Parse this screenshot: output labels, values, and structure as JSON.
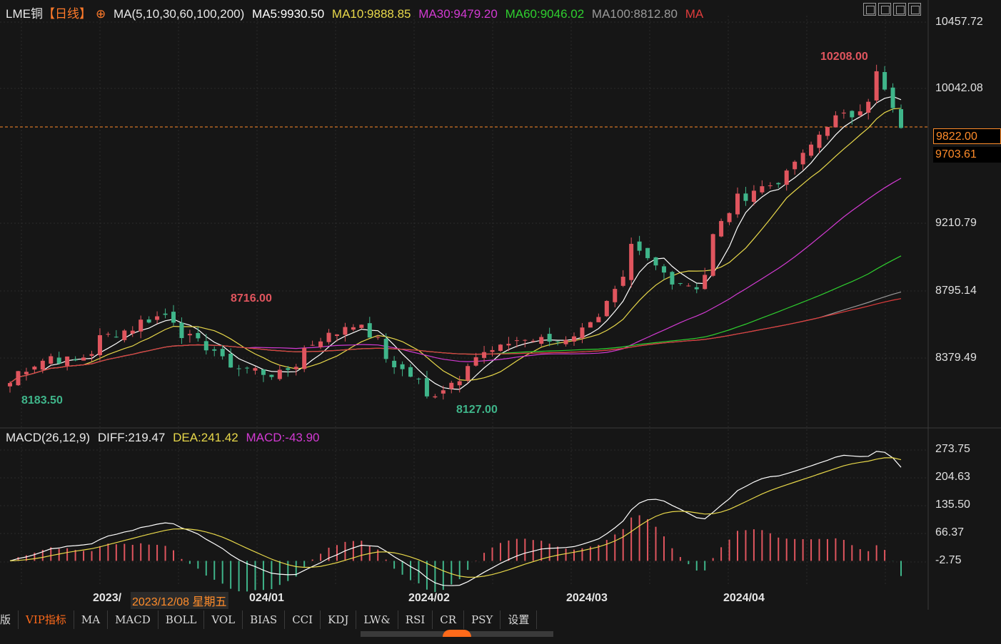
{
  "header": {
    "symbol": "LME铜",
    "period": "【日线】",
    "ma_label": "MA(5,10,30,60,100,200)",
    "ma5": "MA5:9930.50",
    "ma10": "MA10:9888.85",
    "ma30": "MA30:9479.20",
    "ma60": "MA60:9046.02",
    "ma100": "MA100:8812.80",
    "ma200": "MA"
  },
  "macd_header": {
    "label": "MACD(26,12,9)",
    "diff": "DIFF:219.47",
    "dea": "DEA:241.42",
    "macd": "MACD:-43.90"
  },
  "price_axis": [
    "10457.72",
    "10042.08",
    "9210.79",
    "8795.14",
    "8379.49"
  ],
  "current_price": "9822.00",
  "crosshair_price": "9703.61",
  "macd_axis": [
    "273.75",
    "204.63",
    "135.50",
    "66.37",
    "-2.75"
  ],
  "annotations": {
    "high": "10208.00",
    "local_high": "8716.00",
    "start_low": "8183.50",
    "low": "8127.00"
  },
  "date_axis": {
    "first_partial": "2023/",
    "tooltip": "2023/12/08 星期五",
    "jan_partial": "024/01",
    "feb": "2024/02",
    "mar": "2024/03",
    "apr": "2024/04"
  },
  "tabs": [
    "版",
    "VIP指标",
    "MA",
    "MACD",
    "BOLL",
    "VOL",
    "BIAS",
    "CCI",
    "KDJ",
    "LW&",
    "RSI",
    "CR",
    "PSY",
    "设置"
  ],
  "colors": {
    "up": "#e0555e",
    "down": "#3fb58a",
    "ma5": "#ffffff",
    "ma10": "#e8d84a",
    "ma30": "#d23ad2",
    "ma60": "#2fcf2f",
    "ma100": "#9a9a9a",
    "ma200": "#e03c3c",
    "dea": "#e8d84a",
    "diff": "#ffffff"
  },
  "chart_data": {
    "type": "candlestick",
    "title": "LME铜 日线",
    "y_range": [
      8127.0,
      10457.72
    ],
    "anchors": [
      {
        "date": "2023-12-01",
        "close": 8290
      },
      {
        "date": "2023-12-05",
        "close": 8380
      },
      {
        "date": "2023-12-08",
        "close": 8450
      },
      {
        "date": "2023-12-13",
        "close": 8420
      },
      {
        "date": "2023-12-18",
        "close": 8560
      },
      {
        "date": "2023-12-22",
        "close": 8620
      },
      {
        "date": "2023-12-28",
        "close": 8700
      },
      {
        "date": "2024-01-03",
        "close": 8530
      },
      {
        "date": "2024-01-10",
        "close": 8380
      },
      {
        "date": "2024-01-17",
        "close": 8340
      },
      {
        "date": "2024-01-24",
        "close": 8560
      },
      {
        "date": "2024-01-30",
        "close": 8650
      },
      {
        "date": "2024-02-06",
        "close": 8400
      },
      {
        "date": "2024-02-12",
        "close": 8200
      },
      {
        "date": "2024-02-20",
        "close": 8450
      },
      {
        "date": "2024-02-27",
        "close": 8550
      },
      {
        "date": "2024-03-05",
        "close": 8540
      },
      {
        "date": "2024-03-12",
        "close": 8700
      },
      {
        "date": "2024-03-18",
        "close": 9100
      },
      {
        "date": "2024-03-22",
        "close": 8950
      },
      {
        "date": "2024-03-28",
        "close": 8870
      },
      {
        "date": "2024-04-04",
        "close": 9400
      },
      {
        "date": "2024-04-10",
        "close": 9480
      },
      {
        "date": "2024-04-16",
        "close": 9650
      },
      {
        "date": "2024-04-19",
        "close": 9850
      },
      {
        "date": "2024-04-24",
        "close": 9900
      },
      {
        "date": "2024-04-29",
        "close": 10150
      },
      {
        "date": "2024-05-02",
        "close": 9822
      }
    ],
    "highlights": [
      {
        "label": "10208.00",
        "kind": "high"
      },
      {
        "label": "8716.00",
        "kind": "local_high"
      },
      {
        "label": "8183.50",
        "kind": "low"
      },
      {
        "label": "8127.00",
        "kind": "low"
      }
    ],
    "ma_latest": {
      "MA5": 9930.5,
      "MA10": 9888.85,
      "MA30": 9479.2,
      "MA60": 9046.02,
      "MA100": 8812.8
    },
    "macd": {
      "diff": 219.47,
      "dea": 241.42,
      "macd": -43.9,
      "y_range": [
        -2.75,
        273.75
      ]
    }
  }
}
